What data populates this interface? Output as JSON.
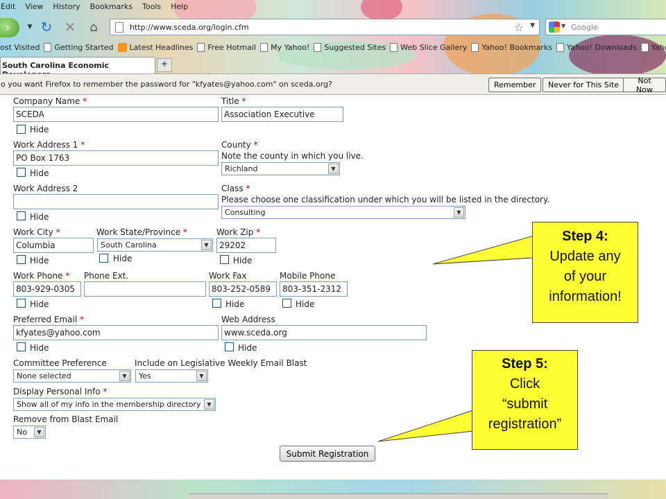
{
  "menu": [
    "Edit",
    "View",
    "History",
    "Bookmarks",
    "Tools",
    "Help"
  ],
  "address": {
    "url": "http://www.sceda.org/login.cfm"
  },
  "search": {
    "placeholder": "Google"
  },
  "bookmarks": [
    {
      "label": "ost Visited",
      "icon": "none"
    },
    {
      "label": "Getting Started",
      "icon": "page-icon"
    },
    {
      "label": "Latest Headlines",
      "icon": "rss-icon"
    },
    {
      "label": "Free Hotmail",
      "icon": "page-icon"
    },
    {
      "label": "My Yahoo!",
      "icon": "page-icon"
    },
    {
      "label": "Suggested Sites",
      "icon": "page-icon"
    },
    {
      "label": "Web Slice Gallery",
      "icon": "page-icon"
    },
    {
      "label": "Yahoo! Bookmarks",
      "icon": "page-icon"
    },
    {
      "label": "Yahoo! Downloads",
      "icon": "page-icon"
    },
    {
      "label": "Yahoo! Mail",
      "icon": "page-icon"
    }
  ],
  "tab": {
    "title": "South Carolina Economic Developers...",
    "new_tab_symbol": "+"
  },
  "notification": {
    "message": "o you want Firefox to remember the password for \"kfyates@yahoo.com\" on sceda.org?",
    "remember": "Remember",
    "never": "Never for This Site",
    "not_now": "Not Now"
  },
  "form": {
    "required_mark": "*",
    "hide_label": "Hide",
    "company_name": {
      "label": "Company Name",
      "value": "SCEDA"
    },
    "title": {
      "label": "Title",
      "value": "Association Executive"
    },
    "work_address_1": {
      "label": "Work Address 1",
      "value": "PO Box 1763"
    },
    "county": {
      "label": "County",
      "note": "Note the county in which you live.",
      "value": "Richland"
    },
    "work_address_2": {
      "label": "Work Address 2",
      "value": ""
    },
    "class": {
      "label": "Class",
      "note": "Please choose one classification under which you will be listed in the directory.",
      "value": "Consulting"
    },
    "work_city": {
      "label": "Work City",
      "value": "Columbia"
    },
    "work_state": {
      "label": "Work State/Province",
      "value": "South Carolina"
    },
    "work_zip": {
      "label": "Work Zip",
      "value": "29202"
    },
    "work_phone": {
      "label": "Work Phone",
      "value": "803-929-0305"
    },
    "phone_ext": {
      "label": "Phone Ext.",
      "value": ""
    },
    "work_fax": {
      "label": "Work Fax",
      "value": "803-252-0589"
    },
    "mobile_phone": {
      "label": "Mobile Phone",
      "value": "803-351-2312"
    },
    "preferred_email": {
      "label": "Preferred Email",
      "value": "kfyates@yahoo.com"
    },
    "web_address": {
      "label": "Web Address",
      "value": "www.sceda.org"
    },
    "committee": {
      "label": "Committee Preference",
      "value": "None selected"
    },
    "legislative": {
      "label": "Include on Legislative Weekly Email Blast",
      "value": "Yes"
    },
    "display_info": {
      "label": "Display Personal Info",
      "value": "Show all of my info in the membership directory"
    },
    "remove_blast": {
      "label": "Remove from Blast Email",
      "value": "No"
    },
    "submit_label": "Submit Registration"
  },
  "callouts": {
    "step4": {
      "heading": "Step 4:",
      "body": [
        "Update any",
        "of your",
        "information!"
      ]
    },
    "step5": {
      "heading": "Step 5:",
      "body": [
        "Click",
        "“submit",
        "registration”"
      ]
    }
  },
  "colors": {
    "callout": "#ffff33",
    "required": "#cc0000",
    "field_border": "#7f9db9"
  }
}
